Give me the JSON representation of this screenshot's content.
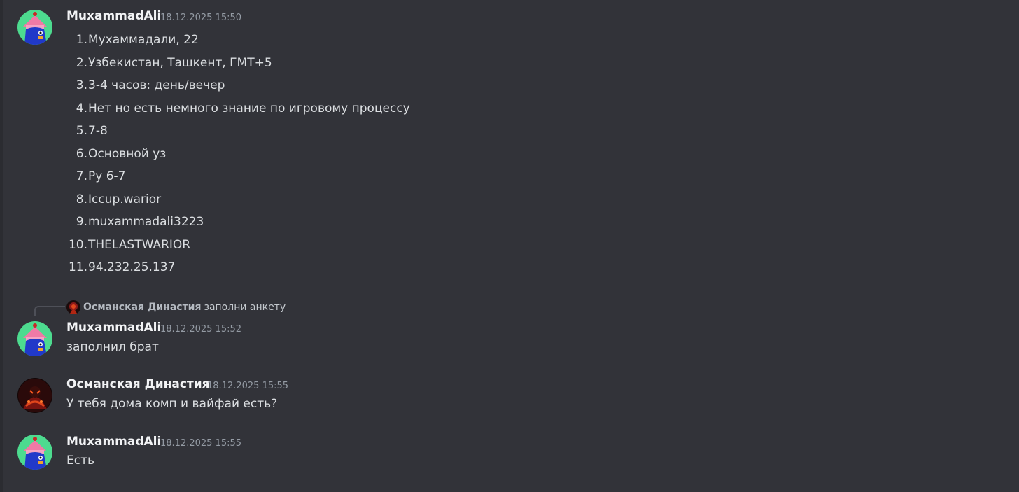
{
  "messages": [
    {
      "author": "MuxammadAli",
      "timestamp": "18.12.2025 15:50",
      "list": [
        {
          "n": "1.",
          "text": "Мухаммадали, 22"
        },
        {
          "n": "2.",
          "text": "Узбекистан, Ташкент, ГМТ+5"
        },
        {
          "n": "3.",
          "text": "3-4 часов: день/вечер"
        },
        {
          "n": "4.",
          "text": "Нет но есть немного знание по игровому процессу"
        },
        {
          "n": "5.",
          "text": "7-8"
        },
        {
          "n": "6.",
          "text": "Основной уз"
        },
        {
          "n": "7.",
          "text": "Ру 6-7"
        },
        {
          "n": "8.",
          "text": "Iccup.warior"
        },
        {
          "n": "9.",
          "text": "muxammadali3223"
        },
        {
          "n": "10.",
          "text": "THELASTWARIOR"
        },
        {
          "n": "11.",
          "text": "94.232.25.137"
        }
      ]
    },
    {
      "reply": {
        "author": "Османская Династия",
        "text": "заполни анкету"
      },
      "author": "MuxammadAli",
      "timestamp": "18.12.2025 15:52",
      "text": "заполнил брат"
    },
    {
      "author": "Османская Династия",
      "timestamp": "18.12.2025 15:55",
      "text": "У тебя дома комп и вайфай есть?"
    },
    {
      "author": "MuxammadAli",
      "timestamp": "18.12.2025 15:55",
      "text": "Есть"
    }
  ],
  "colors": {
    "background": "#323339",
    "author": "#f2f3f5",
    "timestamp": "#949ba4",
    "text": "#dbdee1"
  },
  "icons": {
    "user_avatar": "pink-house-blue-character-avatar",
    "dynasty_avatar": "red-dark-warrior-avatar"
  }
}
